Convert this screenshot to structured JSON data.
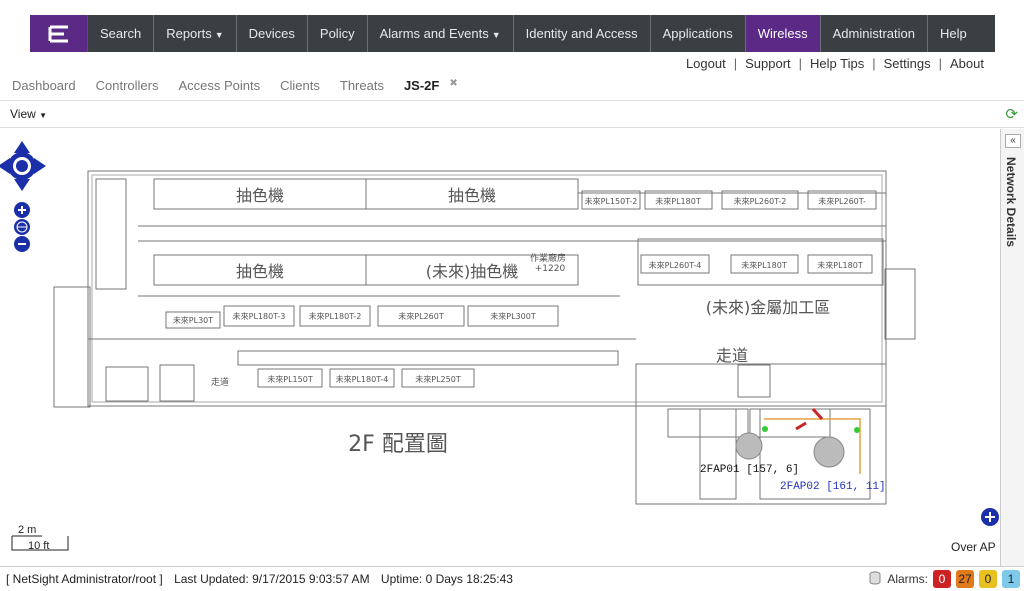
{
  "nav": {
    "logo_icon": "extreme-logo-icon",
    "items": [
      {
        "label": "Search",
        "dropdown": false
      },
      {
        "label": "Reports",
        "dropdown": true
      },
      {
        "label": "Devices",
        "dropdown": false
      },
      {
        "label": "Policy",
        "dropdown": false
      },
      {
        "label": "Alarms and Events",
        "dropdown": true
      },
      {
        "label": "Identity and Access",
        "dropdown": false
      },
      {
        "label": "Applications",
        "dropdown": false
      },
      {
        "label": "Wireless",
        "dropdown": false,
        "active": true
      },
      {
        "label": "Administration",
        "dropdown": false
      },
      {
        "label": "Help",
        "dropdown": false
      }
    ]
  },
  "utility": {
    "logout": "Logout",
    "support": "Support",
    "help_tips": "Help Tips",
    "settings": "Settings",
    "about": "About"
  },
  "subtabs": {
    "dashboard": "Dashboard",
    "controllers": "Controllers",
    "access_points": "Access Points",
    "clients": "Clients",
    "threats": "Threats",
    "current": "JS-2F"
  },
  "toolbar": {
    "view_label": "View"
  },
  "side_panel": {
    "label": "Network Details"
  },
  "map": {
    "labels": {
      "room1": "抽色機",
      "room2": "抽色機",
      "room3": "抽色機",
      "room4": "(未來)抽色機",
      "metal_area": "(未來)金屬加工區",
      "corridor": "走道",
      "corridor_small": "走道",
      "floor_title": "2F 配置圖",
      "work_area": "作業廠房",
      "elevation": "+1220"
    },
    "machines": [
      "未來PL150T-2",
      "未來PL180T",
      "未來PL260T-2",
      "未來PL260T-",
      "未來PL260T-4",
      "未來PL180T",
      "未來PL180T",
      "未來PL30T",
      "未來PL180T-3",
      "未來PL180T-2",
      "未來PL260T",
      "未來PL300T",
      "未來PL150T",
      "未來PL180T-4",
      "未來PL250T"
    ],
    "ap1": "2FAP01 [157, 6]",
    "ap2": "2FAP02 [161, 11]",
    "scale_m": "2 m",
    "scale_ft": "10 ft",
    "over_ap": "Over AP"
  },
  "status": {
    "user": "[ NetSight Administrator/root ]",
    "updated": "Last Updated: 9/17/2015 9:03:57 AM",
    "uptime": "Uptime: 0 Days 18:25:43",
    "alarms_label": "Alarms:",
    "critical": "0",
    "major": "27",
    "minor": "0",
    "info": "1",
    "colors": {
      "critical": "#cc2222",
      "major": "#e07a1a",
      "minor": "#e8c020",
      "info": "#7ec8ea"
    }
  }
}
